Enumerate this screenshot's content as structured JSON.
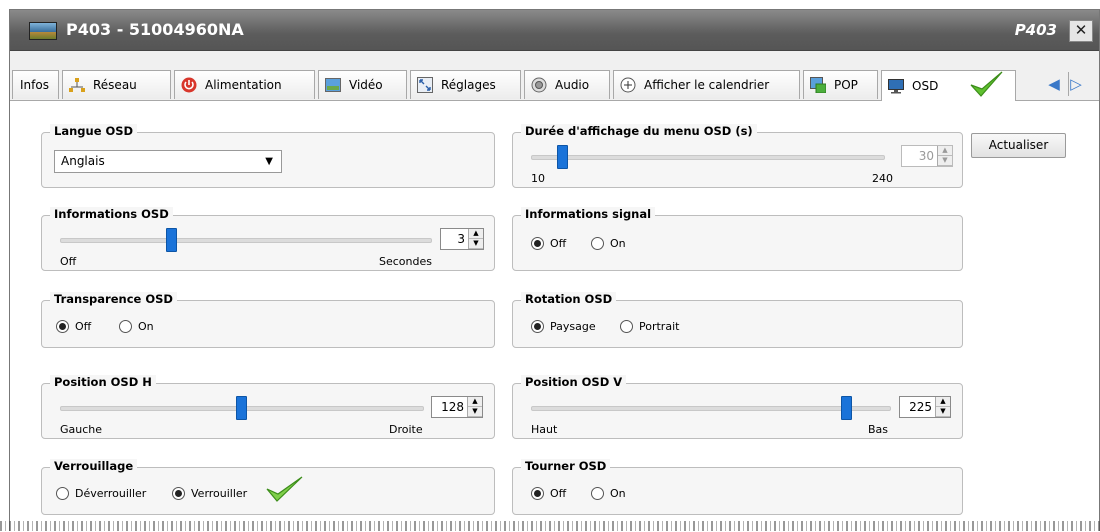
{
  "window": {
    "title": "P403 - 51004960NA",
    "title_right": "P403",
    "close_label": "✕"
  },
  "tabs": [
    {
      "label": "Infos",
      "icon": "none"
    },
    {
      "label": "Réseau",
      "icon": "network-icon"
    },
    {
      "label": "Alimentation",
      "icon": "power-icon"
    },
    {
      "label": "Vidéo",
      "icon": "video-icon"
    },
    {
      "label": "Réglages",
      "icon": "settings-icon"
    },
    {
      "label": "Audio",
      "icon": "speaker-icon"
    },
    {
      "label": "Afficher le calendrier",
      "icon": "plus-circle-icon"
    },
    {
      "label": "POP",
      "icon": "pop-icon"
    },
    {
      "label": "OSD",
      "icon": "monitor-icon",
      "active": true
    }
  ],
  "osd": {
    "langue": {
      "title": "Langue OSD",
      "value": "Anglais"
    },
    "duree": {
      "title": "Durée d'affichage du menu OSD (s)",
      "value": "30",
      "min_label": "10",
      "max_label": "240",
      "min": 10,
      "max": 240,
      "disabled": true
    },
    "informations": {
      "title": "Informations OSD",
      "value": "3",
      "min_label": "Off",
      "max_label": "Secondes",
      "level": 0.3
    },
    "signal": {
      "title": "Informations signal",
      "options": [
        "Off",
        "On"
      ],
      "selected": "Off"
    },
    "transparence": {
      "title": "Transparence OSD",
      "options": [
        "Off",
        "On"
      ],
      "selected": "Off"
    },
    "rotation": {
      "title": "Rotation OSD",
      "options": [
        "Paysage",
        "Portrait"
      ],
      "selected": "Paysage"
    },
    "position_h": {
      "title": "Position OSD H",
      "value": "128",
      "min_label": "Gauche",
      "max_label": "Droite",
      "level": 0.5
    },
    "position_v": {
      "title": "Position OSD V",
      "value": "225",
      "min_label": "Haut",
      "max_label": "Bas",
      "level": 0.88
    },
    "verrouillage": {
      "title": "Verrouillage",
      "options": [
        "Déverrouiller",
        "Verrouiller"
      ],
      "selected": "Verrouiller"
    },
    "tourner": {
      "title": "Tourner OSD",
      "options": [
        "Off",
        "On"
      ],
      "selected": "Off"
    }
  },
  "actions": {
    "refresh_label": "Actualiser"
  },
  "colors": {
    "accent": "#1a73d9",
    "check": "#5fc02f",
    "titlebar": "#5c5c5c"
  }
}
